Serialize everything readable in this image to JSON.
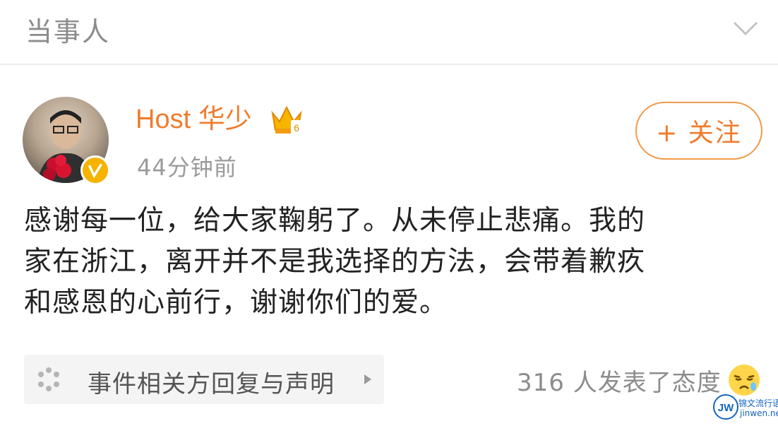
{
  "header": {
    "title": "当事人",
    "collapse_icon": "chevron-down-icon"
  },
  "post": {
    "username": "Host 华少",
    "member_badge_icon": "crown-icon",
    "timestamp": "44分钟前",
    "follow_label": "+ 关注",
    "lines": [
      "感谢每一位，给大家鞠躬了。从未停止悲痛。我的",
      "家在浙江，离开并不是我选择的方法，会带着歉疚",
      "和感恩的心前行，谢谢你们的爱。"
    ]
  },
  "topic": {
    "icon": "topic-dots-icon",
    "label": "事件相关方回复与声明"
  },
  "reactions": {
    "text": "316 人发表了态度",
    "emoji": "sad-emoji-icon"
  },
  "watermark": {
    "cn": "锦文流行语",
    "url": "jinwen.net"
  },
  "colors": {
    "accent": "#f07b2b",
    "muted": "#8c8c8c",
    "badge": "#f6b300"
  }
}
